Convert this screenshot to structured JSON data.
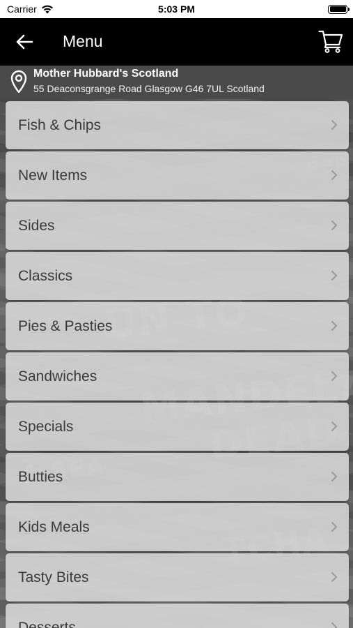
{
  "status_bar": {
    "carrier": "Carrier",
    "time": "5:03 PM"
  },
  "nav": {
    "title": "Menu",
    "back_icon": "arrow-left-icon",
    "cart_icon": "cart-icon"
  },
  "location": {
    "icon": "map-pin-icon",
    "name": "Mother Hubbard's Scotland",
    "address": "55 Deaconsgrange Road Glasgow G46 7UL Scotland"
  },
  "menu": {
    "items": [
      {
        "label": "Fish & Chips"
      },
      {
        "label": "New Items"
      },
      {
        "label": "Sides"
      },
      {
        "label": "Classics"
      },
      {
        "label": "Pies & Pasties"
      },
      {
        "label": "Sandwiches"
      },
      {
        "label": "Specials"
      },
      {
        "label": "Butties"
      },
      {
        "label": "Kids Meals"
      },
      {
        "label": "Tasty Bites"
      },
      {
        "label": "Desserts"
      }
    ]
  },
  "colors": {
    "nav_background": "#000000",
    "menu_item_background": "#dadada",
    "text": "#3a3a3a"
  }
}
